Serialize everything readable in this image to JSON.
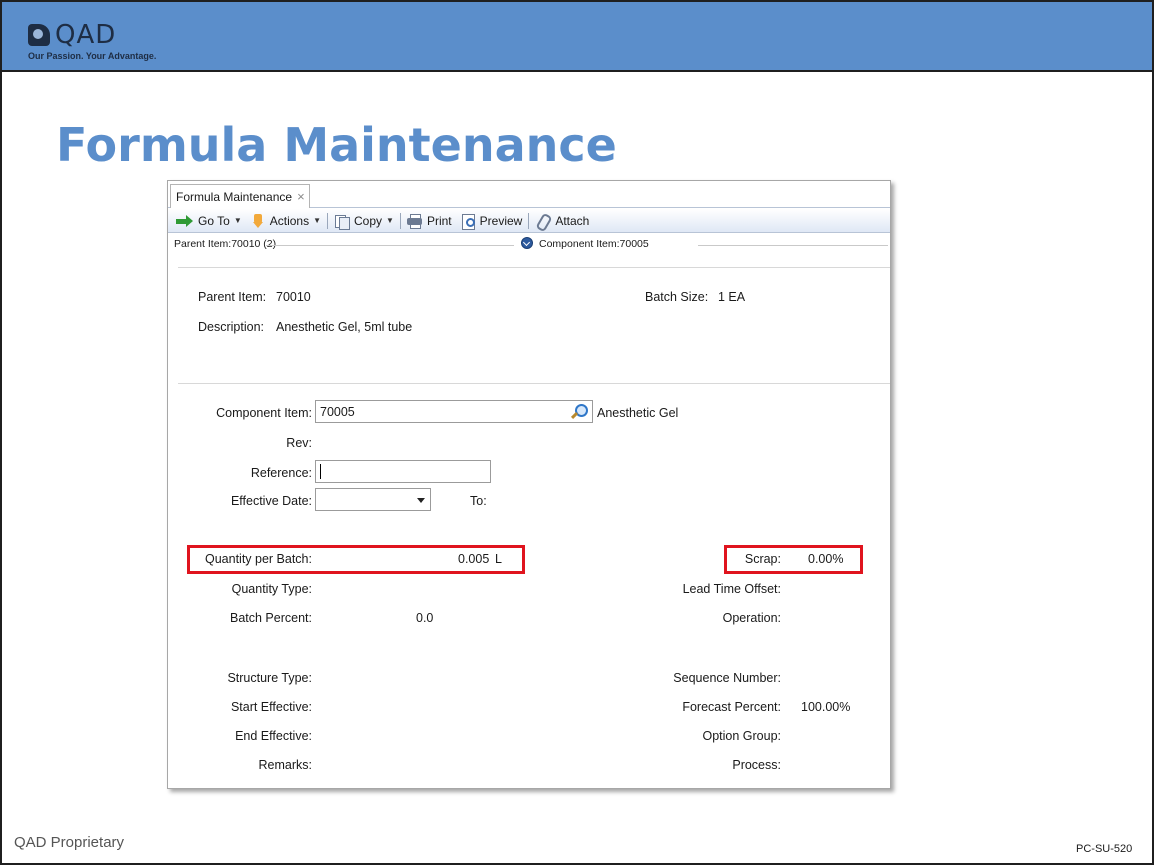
{
  "slide": {
    "logo_text": "QAD",
    "tagline": "Our Passion. Your Advantage.",
    "title": "Formula Maintenance",
    "footer_left": "QAD Proprietary",
    "footer_right": "PC-SU-520"
  },
  "window": {
    "tab_label": "Formula Maintenance",
    "tab_close": "×",
    "toolbar": {
      "goto": "Go To",
      "actions": "Actions",
      "copy": "Copy",
      "print": "Print",
      "preview": "Preview",
      "attach": "Attach"
    },
    "section_header": {
      "parent": "Parent Item:70010 (2)",
      "component": "Component Item:70005"
    },
    "header_info": {
      "parent_item_label": "Parent Item:",
      "parent_item_value": "70010",
      "batch_size_label": "Batch Size:",
      "batch_size_value": "1 EA",
      "description_label": "Description:",
      "description_value": "Anesthetic Gel, 5ml tube"
    },
    "form": {
      "component_item_label": "Component Item:",
      "component_item_value": "70005",
      "component_desc": "Anesthetic Gel",
      "rev_label": "Rev:",
      "reference_label": "Reference:",
      "reference_value": "",
      "effective_date_label": "Effective Date:",
      "effective_date_value": "",
      "to_label": "To:",
      "qty_per_batch_label": "Quantity per Batch:",
      "qty_per_batch_value": "0.005",
      "qty_per_batch_uom": "L",
      "scrap_label": "Scrap:",
      "scrap_value": "0.00%",
      "qty_type_label": "Quantity Type:",
      "lead_time_offset_label": "Lead Time Offset:",
      "batch_percent_label": "Batch Percent:",
      "batch_percent_value": "0.0",
      "operation_label": "Operation:",
      "structure_type_label": "Structure Type:",
      "sequence_number_label": "Sequence Number:",
      "start_effective_label": "Start Effective:",
      "forecast_percent_label": "Forecast Percent:",
      "forecast_percent_value": "100.00%",
      "end_effective_label": "End Effective:",
      "option_group_label": "Option Group:",
      "remarks_label": "Remarks:",
      "process_label": "Process:"
    },
    "highlight_color": "#e0141e",
    "accent_color": "#5b8ecb"
  }
}
